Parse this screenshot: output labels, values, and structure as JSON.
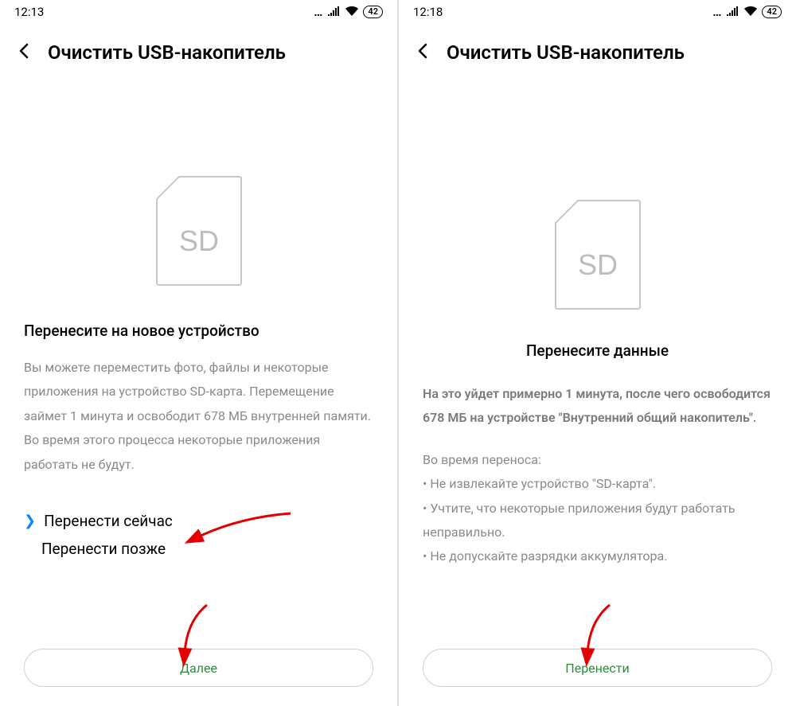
{
  "left": {
    "status": {
      "time": "12:13",
      "battery": "42"
    },
    "header": {
      "title": "Очистить USB-накопитель"
    },
    "sd_label": "SD",
    "subtitle": "Перенесите на новое устройство",
    "body": "Вы можете переместить фото, файлы и некоторые приложения на устройство SD-карта. Перемещение займет 1 минута и освободит 678 МБ внутренней памяти. Во время этого процесса некоторые приложения работать не будут.",
    "options": {
      "now": "Перенести сейчас",
      "later": "Перенести позже"
    },
    "button": "Далее"
  },
  "right": {
    "status": {
      "time": "12:18",
      "battery": "42"
    },
    "header": {
      "title": "Очистить USB-накопитель"
    },
    "sd_label": "SD",
    "subtitle": "Перенесите данные",
    "body_bold": "На это уйдет примерно 1 минута, после чего освободится 678 МБ на устройстве \"Внутренний общий накопитель\".",
    "body_list_heading": "Во время переноса:",
    "body_list": [
      "• Не извлекайте устройство \"SD-карта\".",
      "• Учтите, что некоторые приложения будут работать неправильно.",
      "• Не допускайте разрядки аккумулятора."
    ],
    "button": "Перенести"
  }
}
